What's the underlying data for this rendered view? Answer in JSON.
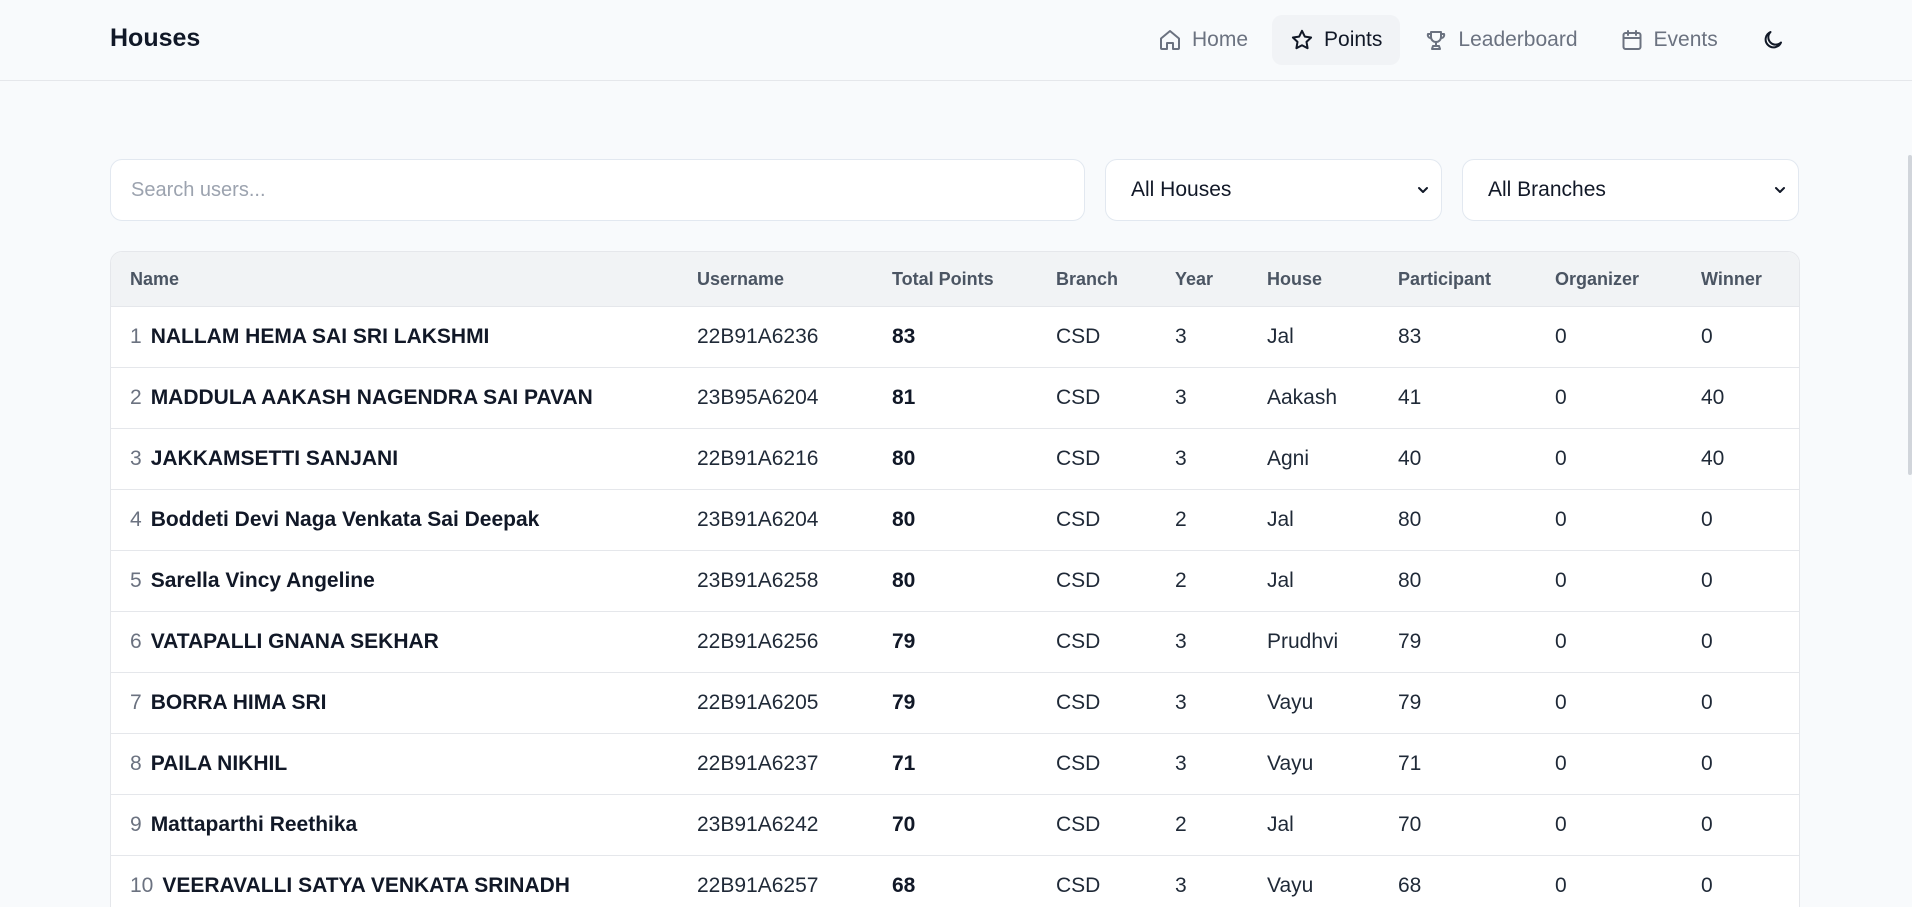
{
  "app": {
    "title": "Houses"
  },
  "nav": {
    "items": [
      {
        "label": "Home",
        "icon": "home-icon",
        "active": false
      },
      {
        "label": "Points",
        "icon": "star-icon",
        "active": true
      },
      {
        "label": "Leaderboard",
        "icon": "trophy-icon",
        "active": false
      },
      {
        "label": "Events",
        "icon": "calendar-icon",
        "active": false
      }
    ],
    "theme_icon": "moon-icon"
  },
  "filters": {
    "search_placeholder": "Search users...",
    "house_selected": "All Houses",
    "branch_selected": "All Branches"
  },
  "table": {
    "headers": {
      "name": "Name",
      "username": "Username",
      "total_points": "Total Points",
      "branch": "Branch",
      "year": "Year",
      "house": "House",
      "participant": "Participant",
      "organizer": "Organizer",
      "winner": "Winner"
    },
    "rows": [
      {
        "rank": "1",
        "name": "NALLAM HEMA SAI SRI LAKSHMI",
        "username": "22B91A6236",
        "total": "83",
        "branch": "CSD",
        "year": "3",
        "house": "Jal",
        "participant": "83",
        "organizer": "0",
        "winner": "0"
      },
      {
        "rank": "2",
        "name": "MADDULA AAKASH NAGENDRA SAI PAVAN",
        "username": "23B95A6204",
        "total": "81",
        "branch": "CSD",
        "year": "3",
        "house": "Aakash",
        "participant": "41",
        "organizer": "0",
        "winner": "40"
      },
      {
        "rank": "3",
        "name": "JAKKAMSETTI SANJANI",
        "username": "22B91A6216",
        "total": "80",
        "branch": "CSD",
        "year": "3",
        "house": "Agni",
        "participant": "40",
        "organizer": "0",
        "winner": "40"
      },
      {
        "rank": "4",
        "name": "Boddeti Devi Naga Venkata Sai Deepak",
        "username": "23B91A6204",
        "total": "80",
        "branch": "CSD",
        "year": "2",
        "house": "Jal",
        "participant": "80",
        "organizer": "0",
        "winner": "0"
      },
      {
        "rank": "5",
        "name": "Sarella Vincy Angeline",
        "username": "23B91A6258",
        "total": "80",
        "branch": "CSD",
        "year": "2",
        "house": "Jal",
        "participant": "80",
        "organizer": "0",
        "winner": "0"
      },
      {
        "rank": "6",
        "name": "VATAPALLI GNANA SEKHAR",
        "username": "22B91A6256",
        "total": "79",
        "branch": "CSD",
        "year": "3",
        "house": "Prudhvi",
        "participant": "79",
        "organizer": "0",
        "winner": "0"
      },
      {
        "rank": "7",
        "name": "BORRA HIMA SRI",
        "username": "22B91A6205",
        "total": "79",
        "branch": "CSD",
        "year": "3",
        "house": "Vayu",
        "participant": "79",
        "organizer": "0",
        "winner": "0"
      },
      {
        "rank": "8",
        "name": "PAILA NIKHIL",
        "username": "22B91A6237",
        "total": "71",
        "branch": "CSD",
        "year": "3",
        "house": "Vayu",
        "participant": "71",
        "organizer": "0",
        "winner": "0"
      },
      {
        "rank": "9",
        "name": "Mattaparthi Reethika",
        "username": "23B91A6242",
        "total": "70",
        "branch": "CSD",
        "year": "2",
        "house": "Jal",
        "participant": "70",
        "organizer": "0",
        "winner": "0"
      },
      {
        "rank": "10",
        "name": "VEERAVALLI SATYA VENKATA SRINADH",
        "username": "22B91A6257",
        "total": "68",
        "branch": "CSD",
        "year": "3",
        "house": "Vayu",
        "participant": "68",
        "organizer": "0",
        "winner": "0"
      }
    ]
  }
}
